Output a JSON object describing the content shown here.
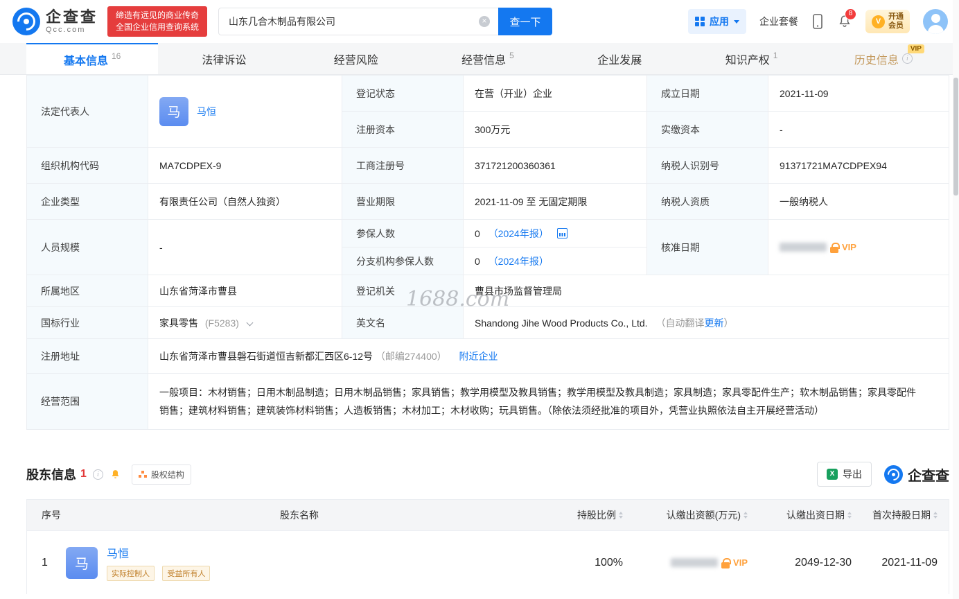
{
  "header": {
    "brand": "企查查",
    "brand_sub": "Qcc.com",
    "slogan_line1": "缔造有远见的商业传奇",
    "slogan_line2": "全国企业信用查询系统",
    "search_value": "山东几合木制品有限公司",
    "search_button": "查一下",
    "apps_label": "应用",
    "package_label": "企业套餐",
    "notification_count": "8",
    "vip_line1": "开通",
    "vip_line2": "会员"
  },
  "tabs": [
    {
      "label": "基本信息",
      "count": "16"
    },
    {
      "label": "法律诉讼",
      "count": ""
    },
    {
      "label": "经营风险",
      "count": ""
    },
    {
      "label": "经营信息",
      "count": "5"
    },
    {
      "label": "企业发展",
      "count": ""
    },
    {
      "label": "知识产权",
      "count": "1"
    },
    {
      "label": "历史信息",
      "count": "",
      "vip_badge": "VIP"
    }
  ],
  "info": {
    "legal_rep": {
      "label": "法定代表人",
      "avatar": "马",
      "name": "马恒"
    },
    "reg_status": {
      "label": "登记状态",
      "value": "在营（开业）企业"
    },
    "est_date": {
      "label": "成立日期",
      "value": "2021-11-09"
    },
    "reg_capital": {
      "label": "注册资本",
      "value": "300万元"
    },
    "paid_capital": {
      "label": "实缴资本",
      "value": "-"
    },
    "org_code": {
      "label": "组织机构代码",
      "value": "MA7CDPEX-9"
    },
    "biz_reg_no": {
      "label": "工商注册号",
      "value": "371721200360361"
    },
    "tax_id": {
      "label": "纳税人识别号",
      "value": "91371721MA7CDPEX94"
    },
    "company_type": {
      "label": "企业类型",
      "value": "有限责任公司（自然人独资）"
    },
    "biz_term": {
      "label": "营业期限",
      "value": "2021-11-09 至 无固定期限"
    },
    "taxpayer_quality": {
      "label": "纳税人资质",
      "value": "一般纳税人"
    },
    "staff_size": {
      "label": "人员规模",
      "value": "-"
    },
    "insured": {
      "label": "参保人数",
      "value": "0",
      "annual": "（2024年报）"
    },
    "branch_insured": {
      "label": "分支机构参保人数",
      "value": "0",
      "annual": "（2024年报）"
    },
    "approval_date": {
      "label": "核准日期",
      "vip": "VIP"
    },
    "region": {
      "label": "所属地区",
      "value": "山东省菏泽市曹县"
    },
    "reg_authority": {
      "label": "登记机关",
      "value": "曹县市场监督管理局"
    },
    "industry": {
      "label": "国标行业",
      "value": "家具零售",
      "code": "(F5283)"
    },
    "en_name": {
      "label": "英文名",
      "value": "Shandong Jihe Wood Products Co., Ltd.",
      "note_prefix": "（自动翻译",
      "note_link": "更新",
      "note_suffix": "）"
    },
    "address": {
      "label": "注册地址",
      "value": "山东省菏泽市曹县磐石街道恒吉新都汇西区6-12号",
      "postcode": "（邮编274400）",
      "nearby_link": "附近企业"
    },
    "biz_scope": {
      "label": "经营范围",
      "value": "一般项目：木材销售；日用木制品制造；日用木制品销售；家具销售；教学用模型及教具销售；教学用模型及教具制造；家具制造；家具零配件生产；软木制品销售；家具零配件销售；建筑材料销售；建筑装饰材料销售；人造板销售；木材加工；木材收购；玩具销售。（除依法须经批准的项目外，凭营业执照依法自主开展经营活动）"
    }
  },
  "shareholders": {
    "title": "股东信息",
    "count": "1",
    "equity_btn": "股权结构",
    "export_btn": "导出",
    "logo_text": "企查查",
    "columns": [
      "序号",
      "股东名称",
      "持股比例",
      "认缴出资额(万元)",
      "认缴出资日期",
      "首次持股日期"
    ],
    "rows": [
      {
        "no": "1",
        "avatar": "马",
        "name": "马恒",
        "tags": [
          "实际控制人",
          "受益所有人"
        ],
        "ratio": "100%",
        "amount_vip": "VIP",
        "subscribe_date": "2049-12-30",
        "first_date": "2021-11-09"
      }
    ]
  },
  "watermark": "1688.com",
  "icons": {
    "clear_glyph": "×",
    "excel_glyph": "X",
    "vip_glyph": "V",
    "info_glyph": "i"
  },
  "colors": {
    "primary": "#1478f0",
    "slogan_red": "#e53d3d",
    "vip_orange": "#ffa13c",
    "label_bg": "#f5fafd",
    "history_tab": "#c49a5e"
  }
}
